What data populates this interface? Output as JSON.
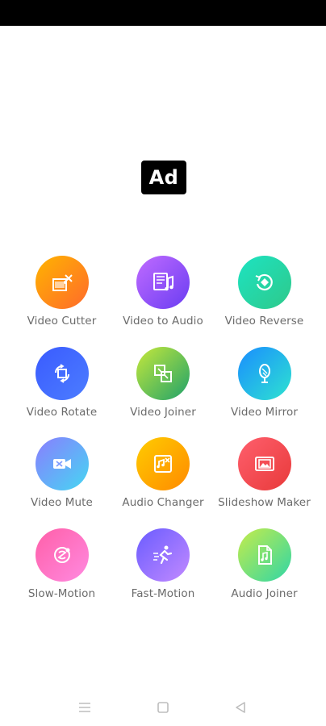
{
  "ad": {
    "label": "Ad"
  },
  "tools": [
    {
      "label": "Video Cutter",
      "icon": "film-scissors-icon",
      "colors": [
        "#ffb400",
        "#ff6a2b"
      ]
    },
    {
      "label": "Video to Audio",
      "icon": "film-music-icon",
      "colors": [
        "#c06bff",
        "#6a3df2"
      ]
    },
    {
      "label": "Video Reverse",
      "icon": "reverse-icon",
      "colors": [
        "#1de3c2",
        "#2ec98a"
      ]
    },
    {
      "label": "Video Rotate",
      "icon": "rotate-icon",
      "colors": [
        "#3a5bff",
        "#4c7dff"
      ]
    },
    {
      "label": "Video Joiner",
      "icon": "joiner-icon",
      "colors": [
        "#c6e83b",
        "#1fa26a"
      ]
    },
    {
      "label": "Video Mirror",
      "icon": "mirror-icon",
      "colors": [
        "#1a8dff",
        "#2ee3d0"
      ]
    },
    {
      "label": "Video Mute",
      "icon": "video-mute-icon",
      "colors": [
        "#8a7dff",
        "#45d7f2"
      ]
    },
    {
      "label": "Audio Changer",
      "icon": "audio-changer-icon",
      "colors": [
        "#ffcc00",
        "#ff8a00"
      ]
    },
    {
      "label": "Slideshow Maker",
      "icon": "slideshow-icon",
      "colors": [
        "#ff5f6d",
        "#e83a3a"
      ]
    },
    {
      "label": "Slow-Motion",
      "icon": "slow-motion-icon",
      "colors": [
        "#ff5fa8",
        "#ff8ae0"
      ]
    },
    {
      "label": "Fast-Motion",
      "icon": "fast-motion-icon",
      "colors": [
        "#6a5cff",
        "#c28aff"
      ]
    },
    {
      "label": "Audio Joiner",
      "icon": "audio-joiner-icon",
      "colors": [
        "#c6ec4a",
        "#2fd6a6"
      ]
    }
  ],
  "navbar": {
    "items": [
      "menu-icon",
      "home-square-icon",
      "back-triangle-icon"
    ]
  }
}
